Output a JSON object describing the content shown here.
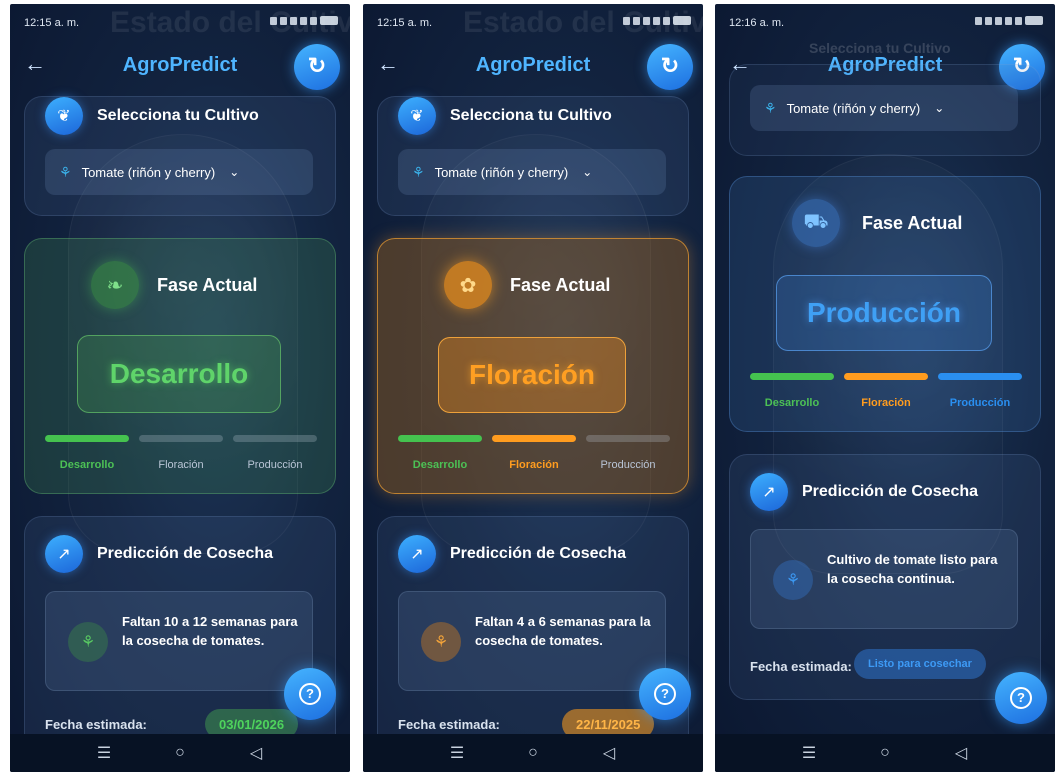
{
  "app_title": "AgroPredict",
  "crop_card_title": "Selecciona tu Cultivo",
  "crop_selected": "Tomate (riñón y cherry)",
  "phase_label": "Fase Actual",
  "prediction_title": "Predicción de Cosecha",
  "date_label": "Fecha estimada:",
  "bg_title_text": "Estado del Cultivo",
  "phase_names": [
    "Desarrollo",
    "Floración",
    "Producción"
  ],
  "screens": [
    {
      "time": "12:15 a. m.",
      "phase": "Desarrollo",
      "phase_color": "#5fd46a",
      "prediction": "Faltan 10 a 12 semanas para la cosecha de tomates.",
      "date": "03/01/2026"
    },
    {
      "time": "12:15 a. m.",
      "phase": "Floración",
      "phase_color": "#ff9f22",
      "prediction": "Faltan 4 a 6 semanas para la cosecha de tomates.",
      "date": "22/11/2025"
    },
    {
      "time": "12:16 a. m.",
      "phase": "Producción",
      "phase_color": "#3fa0f5",
      "prediction": "Cultivo de tomate listo para la cosecha continua.",
      "date": "Listo para cosechar",
      "crop_card_title_faded": "Selecciona tu Cultivo"
    }
  ],
  "icons": {
    "back": "arrow-left-icon",
    "refresh": "refresh-icon",
    "crop": "leaf-icon",
    "help": "help-icon",
    "trend": "trend-icon"
  },
  "nav": {
    "menu": "☰",
    "home": "○",
    "back": "◁"
  }
}
